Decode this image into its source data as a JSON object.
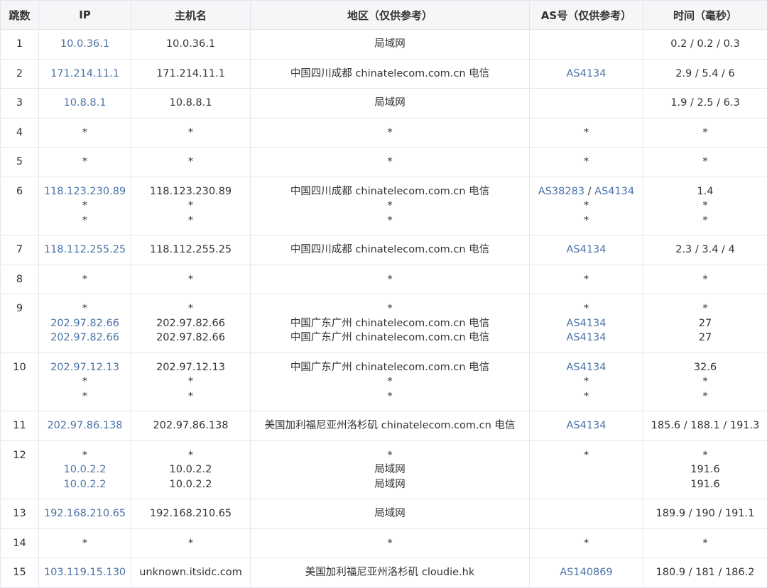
{
  "headers": {
    "hop": "跳数",
    "ip": "IP",
    "host": "主机名",
    "region": "地区（仅供参考）",
    "as": "AS号（仅供参考）",
    "time": "时间（毫秒）"
  },
  "rows": [
    {
      "hop": "1",
      "ips": [
        "10.0.36.1"
      ],
      "hosts": [
        "10.0.36.1"
      ],
      "regions": [
        "局域网"
      ],
      "as": [
        []
      ],
      "times": [
        "0.2 / 0.2 / 0.3"
      ]
    },
    {
      "hop": "2",
      "ips": [
        "171.214.11.1"
      ],
      "hosts": [
        "171.214.11.1"
      ],
      "regions": [
        "中国四川成都 chinatelecom.com.cn 电信"
      ],
      "as": [
        [
          "AS4134"
        ]
      ],
      "times": [
        "2.9 / 5.4 / 6"
      ]
    },
    {
      "hop": "3",
      "ips": [
        "10.8.8.1"
      ],
      "hosts": [
        "10.8.8.1"
      ],
      "regions": [
        "局域网"
      ],
      "as": [
        []
      ],
      "times": [
        "1.9 / 2.5 / 6.3"
      ]
    },
    {
      "hop": "4",
      "ips": [
        "*"
      ],
      "hosts": [
        "*"
      ],
      "regions": [
        "*"
      ],
      "as": [
        [
          "*"
        ]
      ],
      "times": [
        "*"
      ]
    },
    {
      "hop": "5",
      "ips": [
        "*"
      ],
      "hosts": [
        "*"
      ],
      "regions": [
        "*"
      ],
      "as": [
        [
          "*"
        ]
      ],
      "times": [
        "*"
      ]
    },
    {
      "hop": "6",
      "ips": [
        "118.123.230.89",
        "*",
        "*"
      ],
      "hosts": [
        "118.123.230.89",
        "*",
        "*"
      ],
      "regions": [
        "中国四川成都 chinatelecom.com.cn 电信",
        "*",
        "*"
      ],
      "as": [
        [
          "AS38283",
          "AS4134"
        ],
        [
          "*"
        ],
        [
          "*"
        ]
      ],
      "times": [
        "1.4",
        "*",
        "*"
      ]
    },
    {
      "hop": "7",
      "ips": [
        "118.112.255.25"
      ],
      "hosts": [
        "118.112.255.25"
      ],
      "regions": [
        "中国四川成都 chinatelecom.com.cn 电信"
      ],
      "as": [
        [
          "AS4134"
        ]
      ],
      "times": [
        "2.3 / 3.4 / 4"
      ]
    },
    {
      "hop": "8",
      "ips": [
        "*"
      ],
      "hosts": [
        "*"
      ],
      "regions": [
        "*"
      ],
      "as": [
        [
          "*"
        ]
      ],
      "times": [
        "*"
      ]
    },
    {
      "hop": "9",
      "ips": [
        "*",
        "202.97.82.66",
        "202.97.82.66"
      ],
      "hosts": [
        "*",
        "202.97.82.66",
        "202.97.82.66"
      ],
      "regions": [
        "*",
        "中国广东广州 chinatelecom.com.cn 电信",
        "中国广东广州 chinatelecom.com.cn 电信"
      ],
      "as": [
        [
          "*"
        ],
        [
          "AS4134"
        ],
        [
          "AS4134"
        ]
      ],
      "times": [
        "*",
        "27",
        "27"
      ]
    },
    {
      "hop": "10",
      "ips": [
        "202.97.12.13",
        "*",
        "*"
      ],
      "hosts": [
        "202.97.12.13",
        "*",
        "*"
      ],
      "regions": [
        "中国广东广州 chinatelecom.com.cn 电信",
        "*",
        "*"
      ],
      "as": [
        [
          "AS4134"
        ],
        [
          "*"
        ],
        [
          "*"
        ]
      ],
      "times": [
        "32.6",
        "*",
        "*"
      ]
    },
    {
      "hop": "11",
      "ips": [
        "202.97.86.138"
      ],
      "hosts": [
        "202.97.86.138"
      ],
      "regions": [
        "美国加利福尼亚州洛杉矶 chinatelecom.com.cn 电信"
      ],
      "as": [
        [
          "AS4134"
        ]
      ],
      "times": [
        "185.6 / 188.1 / 191.3"
      ]
    },
    {
      "hop": "12",
      "ips": [
        "*",
        "10.0.2.2",
        "10.0.2.2"
      ],
      "hosts": [
        "*",
        "10.0.2.2",
        "10.0.2.2"
      ],
      "regions": [
        "*",
        "局域网",
        "局域网"
      ],
      "as": [
        [
          "*"
        ],
        [],
        []
      ],
      "times": [
        "*",
        "191.6",
        "191.6"
      ]
    },
    {
      "hop": "13",
      "ips": [
        "192.168.210.65"
      ],
      "hosts": [
        "192.168.210.65"
      ],
      "regions": [
        "局域网"
      ],
      "as": [
        []
      ],
      "times": [
        "189.9 / 190 / 191.1"
      ]
    },
    {
      "hop": "14",
      "ips": [
        "*"
      ],
      "hosts": [
        "*"
      ],
      "regions": [
        "*"
      ],
      "as": [
        [
          "*"
        ]
      ],
      "times": [
        "*"
      ]
    },
    {
      "hop": "15",
      "ips": [
        "103.119.15.130"
      ],
      "hosts": [
        "unknown.itsidc.com"
      ],
      "regions": [
        "美国加利福尼亚州洛杉矶 cloudie.hk"
      ],
      "as": [
        [
          "AS140869"
        ]
      ],
      "times": [
        "180.9 / 181 / 186.2"
      ]
    }
  ]
}
